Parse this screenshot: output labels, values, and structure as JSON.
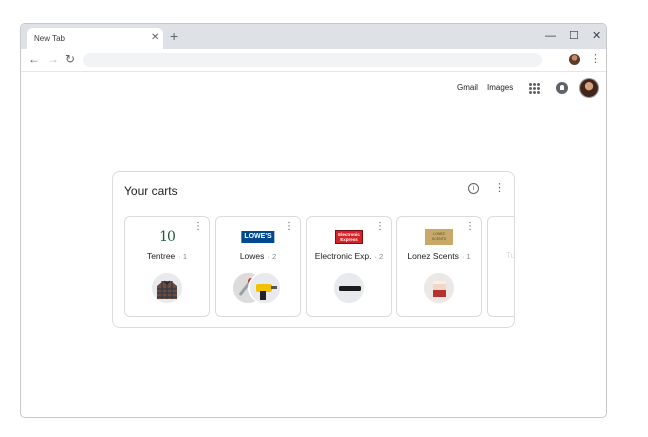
{
  "browser": {
    "tab_title": "New Tab",
    "tab_close": "✕",
    "new_tab": "+",
    "window_controls": {
      "minimize": "—",
      "maximize": "☐",
      "close": "✕"
    },
    "nav": {
      "back": "←",
      "forward": "→",
      "reload": "↻"
    },
    "menu": "⋮"
  },
  "header_links": {
    "gmail": "Gmail",
    "images": "Images"
  },
  "carts": {
    "title": "Your carts",
    "info": "i",
    "menu": "⋮",
    "items": [
      {
        "merchant": "Tentree",
        "count": "· 1",
        "logo": "10",
        "menu": "⋮"
      },
      {
        "merchant": "Lowes",
        "count": "· 2",
        "logo": "LOWE'S",
        "menu": "⋮"
      },
      {
        "merchant": "Electronic Exp.",
        "count": "· 2",
        "logo": "Electronic Express",
        "menu": "⋮"
      },
      {
        "merchant": "Lonez Scents",
        "count": "· 1",
        "logo": "LONEZ SCENTS",
        "menu": "⋮"
      }
    ]
  },
  "colors": {
    "lowes_blue": "#004990",
    "electronic_red": "#d3222a",
    "lonez_gold": "#c8a96a",
    "tentree_green": "#1f5b3a"
  }
}
